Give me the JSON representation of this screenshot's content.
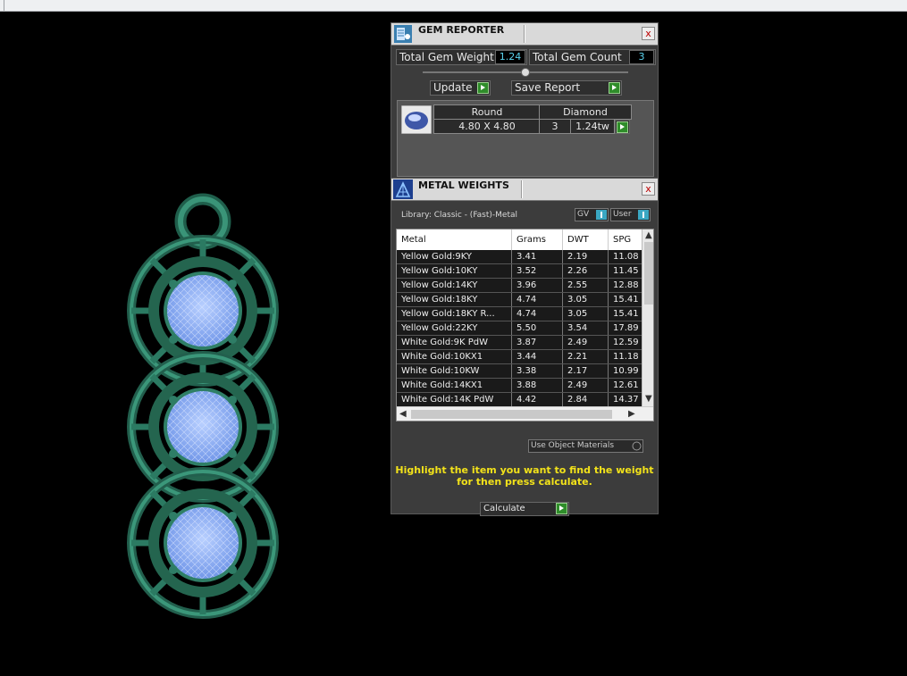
{
  "gem_reporter": {
    "title": "GEM REPORTER",
    "close": "x",
    "total_weight_label": "Total Gem Weight",
    "total_weight_value": "1.24",
    "total_count_label": "Total Gem Count",
    "total_count_value": "3",
    "update_label": "Update",
    "save_report_label": "Save Report",
    "gem": {
      "shape": "Round",
      "material": "Diamond",
      "size": "4.80 X 4.80",
      "count": "3",
      "weight": "1.24tw"
    }
  },
  "metal_weights": {
    "title": "METAL WEIGHTS",
    "close": "x",
    "library": "Library: Classic - (Fast)-Metal",
    "toggle_gv": "GV",
    "toggle_user": "User",
    "columns": [
      "Metal",
      "Grams",
      "DWT",
      "SPG"
    ],
    "rows": [
      [
        "Yellow Gold:9KY",
        "3.41",
        "2.19",
        "11.08"
      ],
      [
        "Yellow Gold:10KY",
        "3.52",
        "2.26",
        "11.45"
      ],
      [
        "Yellow Gold:14KY",
        "3.96",
        "2.55",
        "12.88"
      ],
      [
        "Yellow Gold:18KY",
        "4.74",
        "3.05",
        "15.41"
      ],
      [
        "Yellow Gold:18KY R...",
        "4.74",
        "3.05",
        "15.41"
      ],
      [
        "Yellow Gold:22KY",
        "5.50",
        "3.54",
        "17.89"
      ],
      [
        "White Gold:9K PdW",
        "3.87",
        "2.49",
        "12.59"
      ],
      [
        "White Gold:10KX1",
        "3.44",
        "2.21",
        "11.18"
      ],
      [
        "White Gold:10KW",
        "3.38",
        "2.17",
        "10.99"
      ],
      [
        "White Gold:14KX1",
        "3.88",
        "2.49",
        "12.61"
      ],
      [
        "White Gold:14K PdW",
        "4.42",
        "2.84",
        "14.37"
      ]
    ],
    "use_object_materials": "Use Object Materials",
    "hint_line1": "Highlight the item you want to find the weight",
    "hint_line2": "for then press calculate.",
    "calculate_label": "Calculate"
  },
  "colors": {
    "metal": "#2e7d66",
    "gem": "#8fb6ff",
    "value_text": "#5bd3ee",
    "hint_text": "#f2e21a",
    "go_button": "#2f8d2a"
  }
}
